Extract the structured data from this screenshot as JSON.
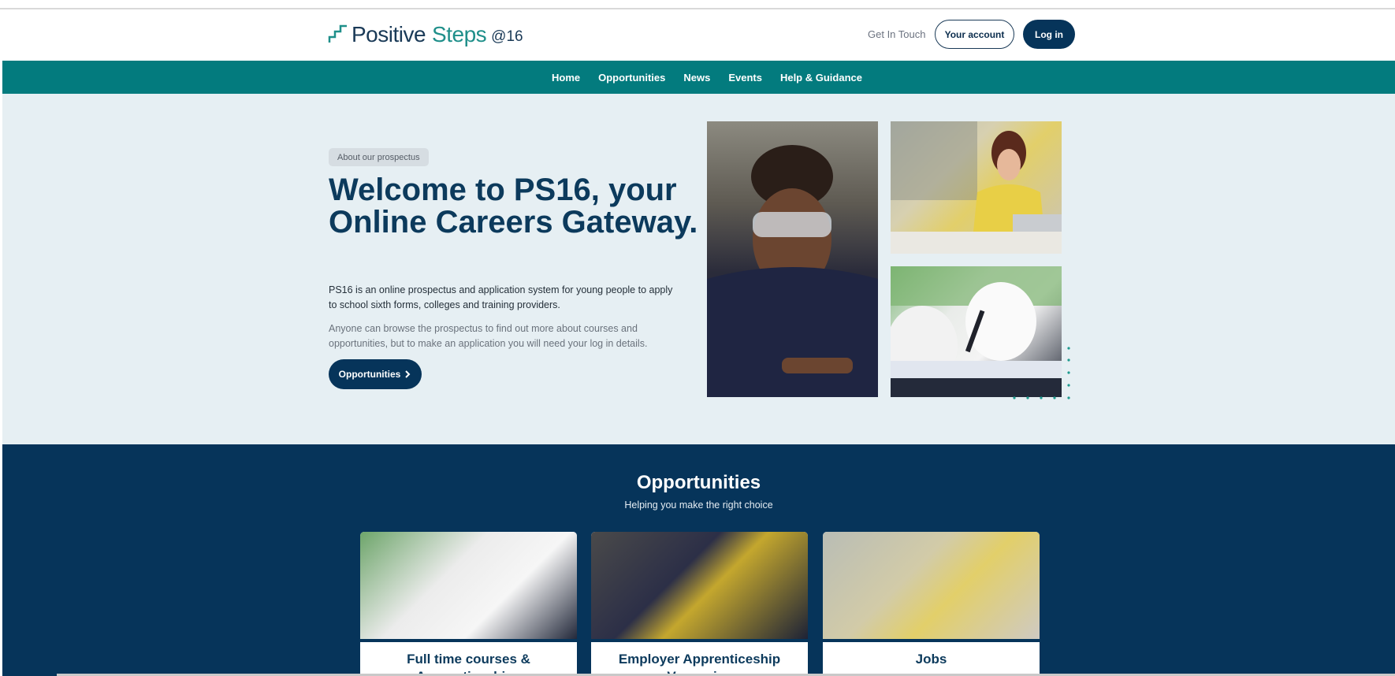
{
  "brand": {
    "logo_word1": "Positive",
    "logo_word2": "Steps",
    "logo_suffix": "@16",
    "primary_color": "#06345a",
    "accent_color": "#037b7e"
  },
  "header": {
    "get_in_touch": "Get In Touch",
    "your_account": "Your account",
    "log_in": "Log in"
  },
  "nav": {
    "items": [
      {
        "label": "Home"
      },
      {
        "label": "Opportunities"
      },
      {
        "label": "News"
      },
      {
        "label": "Events"
      },
      {
        "label": "Help & Guidance"
      }
    ]
  },
  "hero": {
    "badge": "About our prospectus",
    "title": "Welcome to PS16, your Online Careers Gateway.",
    "paragraph1": "PS16 is an online prospectus and application system for young people to apply to school sixth forms, colleges and training providers.",
    "paragraph2": "Anyone can browse the prospectus to find out more about courses and opportunities, but to make an application you will need your log in details.",
    "button_label": "Opportunities",
    "button_icon": "chevron-right-icon"
  },
  "opportunities": {
    "title": "Opportunities",
    "subtitle": "Helping you make the right choice",
    "cards": [
      {
        "title": "Full time courses & Apprenticeships"
      },
      {
        "title": "Employer Apprenticeship Vacancies"
      },
      {
        "title": "Jobs"
      }
    ]
  }
}
